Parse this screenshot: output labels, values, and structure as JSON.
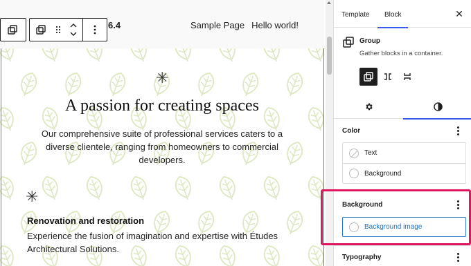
{
  "site": {
    "version_text": "6.4",
    "nav": [
      "Sample Page",
      "Hello world!"
    ]
  },
  "canvas": {
    "hero_title": "A passion for creating spaces",
    "hero_text": "Our comprehensive suite of professional services caters to a diverse clientele, ranging from homeowners to commercial developers.",
    "service_title": "Renovation and restoration",
    "service_text": "Experience the fusion of imagination and expertise with Études Architectural Solutions."
  },
  "sidebar": {
    "tabs": [
      "Template",
      "Block"
    ],
    "active_tab": "Block",
    "block": {
      "name": "Group",
      "description": "Gather blocks in a container."
    },
    "color_panel": {
      "title": "Color",
      "items": [
        "Text",
        "Background"
      ]
    },
    "background_panel": {
      "title": "Background",
      "button_label": "Background image"
    },
    "typography_panel": {
      "title": "Typography"
    }
  },
  "colors": {
    "accent": "#3858e9",
    "highlight": "#e0155f",
    "selection": "#3a86c8",
    "leaf": "#dfe8c4"
  }
}
